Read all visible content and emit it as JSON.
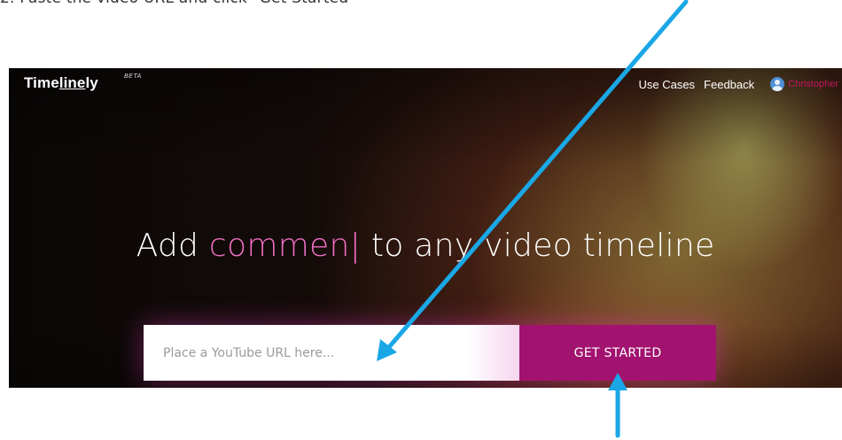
{
  "caption": {
    "text": "2. Paste the video URL and click \"Get Started\""
  },
  "header": {
    "logo_pre": "Time",
    "logo_underlined": "line",
    "logo_post": "ly",
    "badge": "BETA",
    "nav": {
      "use_cases": "Use Cases",
      "feedback": "Feedback",
      "user_name": "Christopher"
    }
  },
  "hero": {
    "headline_pre": "Add ",
    "headline_accent": "commen",
    "headline_cursor": "|",
    "headline_post": " to any video timeline",
    "input_placeholder": "Place a YouTube URL here...",
    "button_label": "GET STARTED"
  },
  "colors": {
    "accent_pink": "#f06fc4",
    "button_magenta": "#a2126f",
    "arrow_blue": "#1aa7e6"
  },
  "icons": {
    "avatar": "user-avatar-icon",
    "arrows": "annotation-arrow"
  }
}
